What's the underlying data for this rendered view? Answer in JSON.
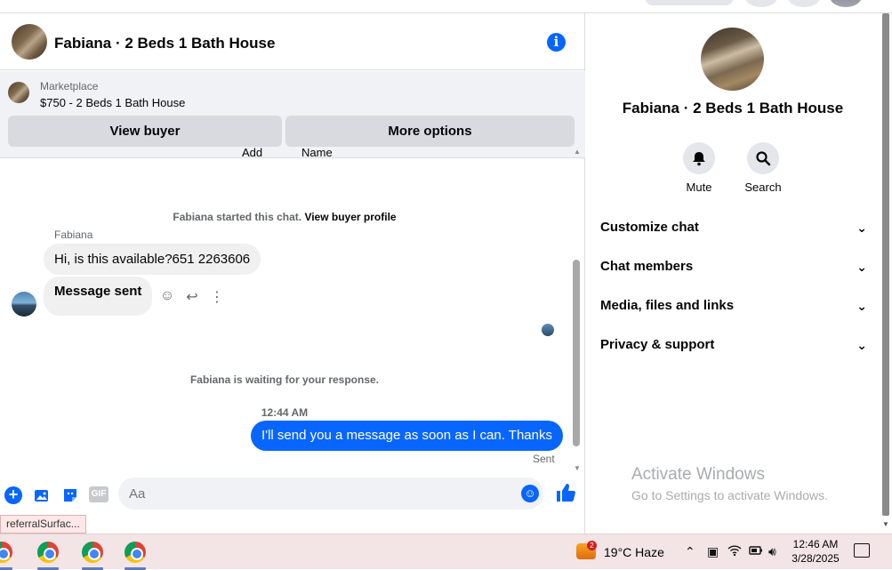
{
  "chat_header": {
    "title": "Fabiana · 2 Beds 1 Bath House"
  },
  "marketplace": {
    "label": "Marketplace",
    "price_line": "$750 - 2 Beds 1 Bath House",
    "view_buyer_label": "View buyer",
    "more_options_label": "More options"
  },
  "messages": {
    "sub_header_add": "Add",
    "sub_header_name": "Name",
    "started_text": "Fabiana started this chat. ",
    "view_profile_link": "View buyer profile",
    "sender_name": "Fabiana",
    "msg1": "Hi, is this available?651 2263606",
    "msg2": "Message sent",
    "waiting_text": "Fabiana is waiting for your response.",
    "timestamp": "12:44 AM",
    "msg_out": "I'll send you a message as soon as I can. Thanks",
    "sent_label": "Sent"
  },
  "composer": {
    "placeholder": "Aa",
    "gif_label": "GIF"
  },
  "tooltip": {
    "text": "referralSurfac..."
  },
  "right_panel": {
    "title": "Fabiana · 2 Beds 1 Bath House",
    "mute_label": "Mute",
    "search_label": "Search",
    "rows": [
      {
        "label": "Customize chat"
      },
      {
        "label": "Chat members"
      },
      {
        "label": "Media, files and links"
      },
      {
        "label": "Privacy & support"
      }
    ],
    "watermark_title": "Activate Windows",
    "watermark_sub": "Go to Settings to activate Windows."
  },
  "taskbar": {
    "weather_badge": "2",
    "weather": "19°C  Haze",
    "time": "12:46 AM",
    "date": "3/28/2025"
  },
  "colors": {
    "accent": "#0866ff",
    "bubble_in": "#f0f0f0",
    "panel_bg": "#f0f2f5",
    "taskbar_bg": "#f3e4e6"
  }
}
